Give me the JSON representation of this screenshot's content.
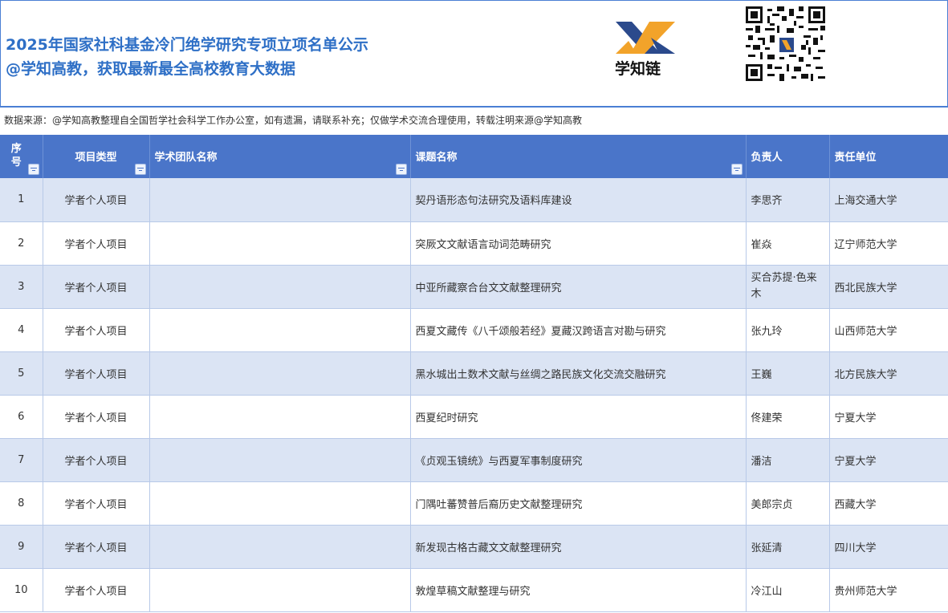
{
  "header": {
    "title_line1": "2025年国家社科基金冷门绝学研究专项立项名单公示",
    "title_line2": "@学知高教，获取最新最全高校教育大数据",
    "logo_text": "学知链",
    "logo_icon": "xuezhilian-logo",
    "qr_icon": "qr-code-icon"
  },
  "source_note": "数据来源：@学知高教整理自全国哲学社会科学工作办公室，如有遗漏，请联系补充；仅做学术交流合理使用，转载注明来源@学知高教",
  "colors": {
    "header_blue": "#4a75c9",
    "title_blue": "#2e6fc6",
    "row_stripe": "#dbe4f4"
  },
  "table": {
    "columns": [
      "序号",
      "项目类型",
      "学术团队名称",
      "课题名称",
      "负责人",
      "责任单位"
    ],
    "rows": [
      {
        "no": "1",
        "type": "学者个人项目",
        "team": "",
        "topic": "契丹语形态句法研究及语料库建设",
        "leader": "李思齐",
        "unit": "上海交通大学"
      },
      {
        "no": "2",
        "type": "学者个人项目",
        "team": "",
        "topic": "突厥文文献语言动词范畴研究",
        "leader": "崔焱",
        "unit": "辽宁师范大学"
      },
      {
        "no": "3",
        "type": "学者个人项目",
        "team": "",
        "topic": "中亚所藏察合台文文献整理研究",
        "leader": "买合苏提·色来木",
        "unit": "西北民族大学"
      },
      {
        "no": "4",
        "type": "学者个人项目",
        "team": "",
        "topic": "西夏文藏传《八千颂般若经》夏藏汉跨语言对勘与研究",
        "leader": "张九玲",
        "unit": "山西师范大学"
      },
      {
        "no": "5",
        "type": "学者个人项目",
        "team": "",
        "topic": "黑水城出土数术文献与丝绸之路民族文化交流交融研究",
        "leader": "王巍",
        "unit": "北方民族大学"
      },
      {
        "no": "6",
        "type": "学者个人项目",
        "team": "",
        "topic": "西夏纪时研究",
        "leader": "佟建荣",
        "unit": "宁夏大学"
      },
      {
        "no": "7",
        "type": "学者个人项目",
        "team": "",
        "topic": "《贞观玉镜统》与西夏军事制度研究",
        "leader": "潘洁",
        "unit": "宁夏大学"
      },
      {
        "no": "8",
        "type": "学者个人项目",
        "team": "",
        "topic": "门隅吐蕃赞普后裔历史文献整理研究",
        "leader": "美郎宗贞",
        "unit": "西藏大学"
      },
      {
        "no": "9",
        "type": "学者个人项目",
        "team": "",
        "topic": "新发现古格古藏文文献整理研究",
        "leader": "张延清",
        "unit": "四川大学"
      },
      {
        "no": "10",
        "type": "学者个人项目",
        "team": "",
        "topic": "敦煌草稿文献整理与研究",
        "leader": "冷江山",
        "unit": "贵州师范大学"
      }
    ]
  }
}
